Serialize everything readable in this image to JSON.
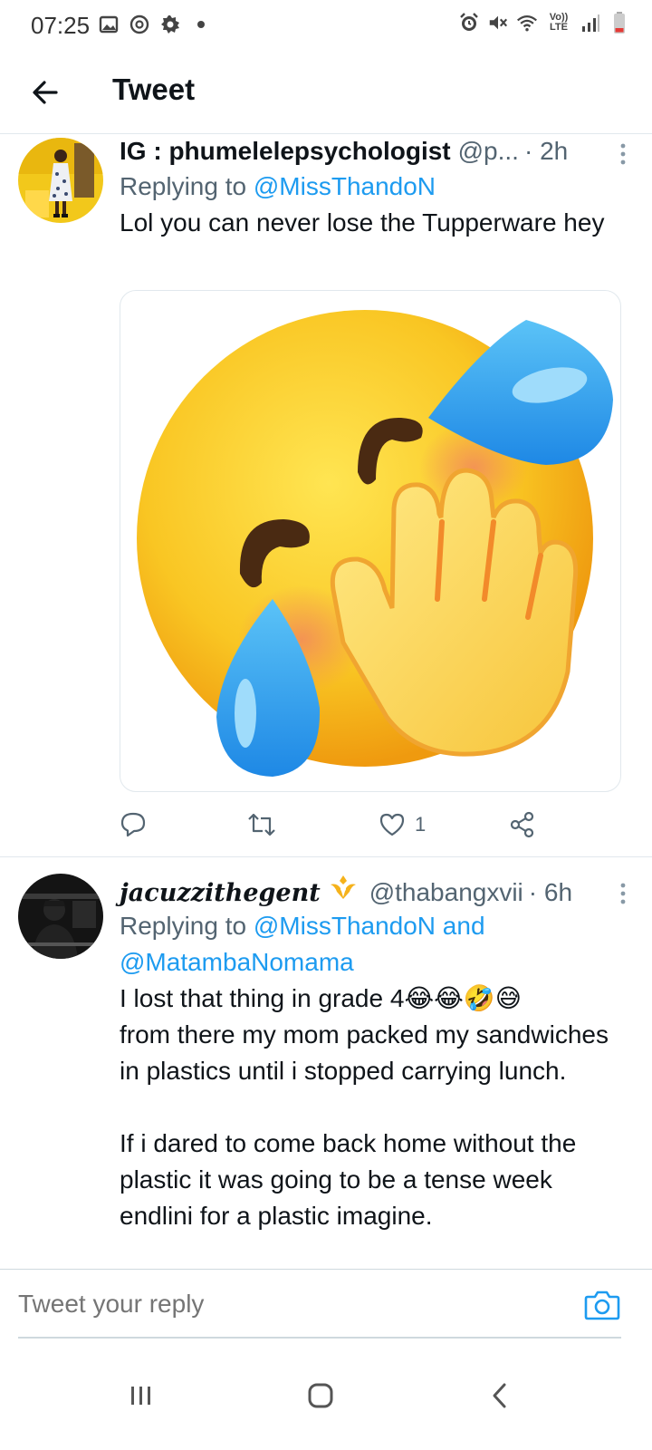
{
  "status_bar": {
    "time": "07:25",
    "left_icons": [
      "image-icon",
      "sync-icon",
      "settings-icon",
      "dot-icon"
    ],
    "right_icons": [
      "alarm-icon",
      "mute-icon",
      "wifi-icon",
      "volte-icon",
      "signal-icon",
      "battery-icon"
    ],
    "network_top": "Vo))",
    "network_bottom": "LTE"
  },
  "header": {
    "title": "Tweet"
  },
  "tweets": [
    {
      "name": "IG : phumelelepsychologist",
      "handle": "@p...",
      "time": "· 2h",
      "replying_prefix": "Replying to ",
      "replying_to": [
        "@MissThandoN"
      ],
      "text": "Lol you can never lose the Tupperware hey",
      "media": "face-palm-sweat-emoji",
      "actions": {
        "reply_count": "",
        "retweet_count": "",
        "like_count": "1",
        "share": ""
      }
    },
    {
      "name": "jacuzzithegent",
      "handle": "@thabangxvii",
      "time": "· 6h",
      "replying_prefix": "Replying to ",
      "replying_to": [
        "@MissThandoN",
        "@MatambaNomama"
      ],
      "replying_joiner": " and ",
      "text_line1": "I lost that thing in grade 4",
      "emojis": [
        "😂",
        "😂",
        "🤣",
        "😅"
      ],
      "text_rest": "from there my mom packed my sandwiches in plastics until i stopped carrying lunch.\n\nIf i dared to come back home without the plastic it was going to be a tense week endlini for a plastic imagine."
    }
  ],
  "composer": {
    "placeholder": "Tweet your reply"
  },
  "colors": {
    "accent": "#1d9bf0",
    "secondary_text": "#536471",
    "divider": "#e1e8ed"
  }
}
